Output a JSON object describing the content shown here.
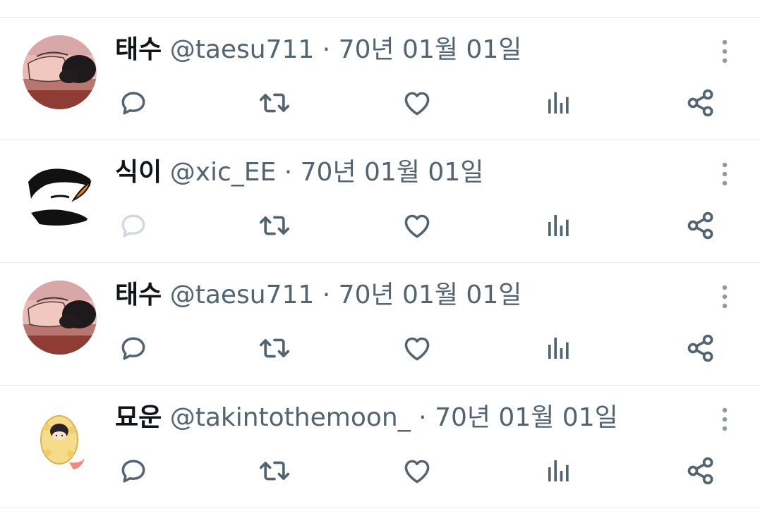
{
  "tweets": [
    {
      "name": "태수",
      "handle": "@taesu711",
      "separator": "·",
      "date": "70년 01월 01일",
      "avatar_icon": "avatar-sleeping-person",
      "reply_enabled": true
    },
    {
      "name": "식이",
      "handle": "@xic_EE",
      "separator": "·",
      "date": "70년 01월 01일",
      "avatar_icon": "avatar-doodle-face",
      "reply_enabled": false
    },
    {
      "name": "태수",
      "handle": "@taesu711",
      "separator": "·",
      "date": "70년 01월 01일",
      "avatar_icon": "avatar-sleeping-person",
      "reply_enabled": true
    },
    {
      "name": "묘운",
      "handle": "@takintothemoon_",
      "separator": "·",
      "date": "70년 01월 01일",
      "avatar_icon": "avatar-fried-shrimp-character",
      "reply_enabled": true
    }
  ],
  "action_icons": [
    "reply-icon",
    "repost-icon",
    "like-icon",
    "views-icon",
    "share-icon"
  ],
  "colors": {
    "icon": "#536471",
    "icon_disabled": "#cfd9de",
    "text_primary": "#0f1419",
    "text_secondary": "#536471",
    "divider": "#e6e9ec"
  }
}
